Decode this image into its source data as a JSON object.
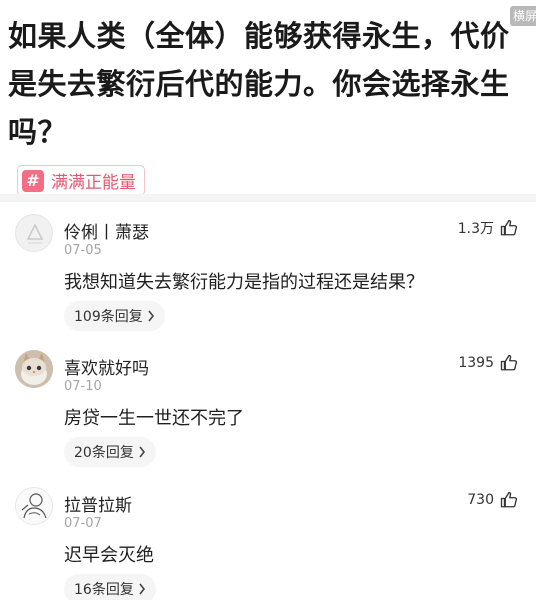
{
  "corner_badge": "横屏",
  "question": {
    "title": "如果人类（全体）能够获得永生，代价是失去繁衍后代的能力。你会选择永生吗？",
    "topic_tag_icon": "#",
    "topic_tag": "满满正能量"
  },
  "comments": [
    {
      "username": "伶俐丨萧瑟",
      "date": "07-05",
      "likes": "1.3万",
      "content": "我想知道失去繁衍能力是指的过程还是结果？",
      "replies": "109条回复",
      "avatar": "default-avatar-icon"
    },
    {
      "username": "喜欢就好吗",
      "date": "07-10",
      "likes": "1395",
      "content": "房贷一生一世还不完了",
      "replies": "20条回复",
      "avatar": "cat-avatar"
    },
    {
      "username": "拉普拉斯",
      "date": "07-07",
      "likes": "730",
      "content": "迟早会灭绝",
      "replies": "16条回复",
      "avatar": "sketch-avatar"
    }
  ],
  "icons": {
    "like": "thumbs-up-icon",
    "chevron": "chevron-right-icon"
  },
  "colors": {
    "tag_accent": "#e5596f",
    "tag_icon_bg": "#f56c85",
    "muted_text": "#a5a5a5"
  }
}
